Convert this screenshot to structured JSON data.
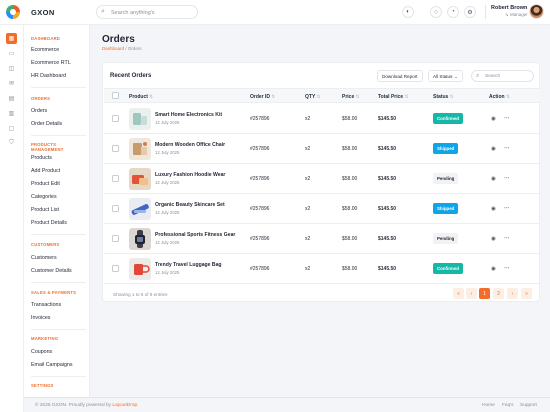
{
  "header": {
    "brand": "GXON",
    "search_placeholder": "Search anything's",
    "user_name": "Robert Brown",
    "user_role": "Manager"
  },
  "sidebar": {
    "sections": [
      {
        "title": "DASHBOARD",
        "items": [
          "Ecommerce",
          "Ecommerce RTL",
          "HR Dashboard"
        ]
      },
      {
        "title": "ORDERS",
        "items": [
          "Orders",
          "Order Details"
        ]
      },
      {
        "title": "PRODUCTS MANAGEMENT",
        "items": [
          "Products",
          "Add Product",
          "Product Edit",
          "Categories",
          "Product List",
          "Product Details"
        ]
      },
      {
        "title": "CUSTOMERS",
        "items": [
          "Customers",
          "Customer Details"
        ]
      },
      {
        "title": "SALES & PAYMENTS",
        "items": [
          "Transactions",
          "Invoices"
        ]
      },
      {
        "title": "MARKETING",
        "items": [
          "Coupons",
          "Email Campaigns"
        ]
      },
      {
        "title": "SETTINGS",
        "items": []
      }
    ]
  },
  "page": {
    "title": "Orders",
    "breadcrumb_home": "Dashboard",
    "breadcrumb_sep": "/",
    "breadcrumb_current": "Orders"
  },
  "card": {
    "title": "Recent Orders",
    "download_label": "Download Report",
    "status_filter": "All Status",
    "search_placeholder": "Search",
    "columns": [
      "Product",
      "Order ID",
      "QTY",
      "Price",
      "Total Price",
      "Status",
      "Action"
    ],
    "rows": [
      {
        "name": "Smart Home Electronics Kit",
        "date": "12 July 2025",
        "order_id": "#257896",
        "qty": "x2",
        "price": "$58.00",
        "total": "$145.50",
        "status": "Confirmed",
        "thumb": "electronics"
      },
      {
        "name": "Modern Wooden Office Chair",
        "date": "12 July 2025",
        "order_id": "#257896",
        "qty": "x2",
        "price": "$58.00",
        "total": "$145.50",
        "status": "Shipped",
        "thumb": "chair"
      },
      {
        "name": "Luxury Fashion Hoodie Wear",
        "date": "12 July 2025",
        "order_id": "#257896",
        "qty": "x2",
        "price": "$58.00",
        "total": "$145.50",
        "status": "Pending",
        "thumb": "hoodie"
      },
      {
        "name": "Organic Beauty Skincare Set",
        "date": "12 July 2025",
        "order_id": "#257896",
        "qty": "x2",
        "price": "$58.00",
        "total": "$145.50",
        "status": "Shipped",
        "thumb": "skincare"
      },
      {
        "name": "Professional Sports Fitness Gear",
        "date": "12 July 2025",
        "order_id": "#257896",
        "qty": "x2",
        "price": "$58.00",
        "total": "$145.50",
        "status": "Pending",
        "thumb": "watch"
      },
      {
        "name": "Trendy Travel Luggage Bag",
        "date": "12 July 2025",
        "order_id": "#257896",
        "qty": "x2",
        "price": "$58.00",
        "total": "$145.50",
        "status": "Confirmed",
        "thumb": "mug"
      }
    ],
    "showing_text": "Showing 1 to 6 of 9 entries",
    "pages": [
      "«",
      "‹",
      "1",
      "2",
      "›",
      "»"
    ],
    "current_page": "1"
  },
  "footer": {
    "copyright": "© 2025 GXON. Proudly powered by",
    "powered_by": "LayoutDrop.",
    "links": [
      "Home",
      "Faq's",
      "Support"
    ]
  },
  "colors": {
    "accent": "#f26d2b",
    "confirmed": "#14b8a6",
    "shipped": "#0ea5e9",
    "pending_bg": "#f1f2f4"
  }
}
